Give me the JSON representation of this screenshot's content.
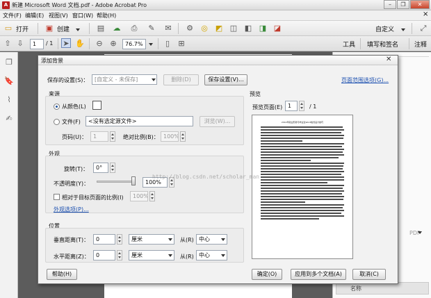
{
  "window": {
    "title": "新建 Microsoft Word 文档.pdf - Adobe Acrobat Pro",
    "app_icon_glyph": "A",
    "controls": {
      "minimize": "–",
      "restore": "❐",
      "close": "✕"
    }
  },
  "menubar": {
    "items": [
      "文件(F)",
      "编辑(E)",
      "视图(V)",
      "窗口(W)",
      "帮助(H)"
    ],
    "close_glyph": "×"
  },
  "toolbar1": {
    "open_label": "打开",
    "create_label": "创建",
    "customize_label": "自定义"
  },
  "toolbar2": {
    "page_current": "1",
    "page_total": "/ 1",
    "zoom": "76.7%",
    "tools_label": "工具",
    "sign_label": "填写和签名",
    "comment_label": "注释"
  },
  "dialog": {
    "title": "添加背景",
    "saved_settings_label": "保存的设置(S)：",
    "saved_settings_value": "[自定义 - 未保存]",
    "delete_button": "删除(D)",
    "save_settings_button": "保存设置(V)...",
    "page_range_link": "页面范围选项(G)...",
    "source": {
      "header": "来源",
      "from_color_label": "从颜色(L)",
      "from_file_label": "文件(F)",
      "file_placeholder": "<没有选定源文件>",
      "browse_button": "浏览(W)...",
      "page_no_label": "页码(U)：",
      "page_no_value": "1",
      "abs_scale_label": "绝对比例(B)：",
      "abs_scale_value": "100%"
    },
    "appearance": {
      "header": "外观",
      "rotation_label": "旋转(T)：",
      "rotation_value": "0°",
      "opacity_label": "不透明度(Y)：",
      "opacity_value": "100%",
      "opacity_fraction": 1.0,
      "relative_scale_label": "相对于目标页面的比例(I)",
      "relative_scale_value": "100%",
      "options_link": "外观选项(P)..."
    },
    "position": {
      "header": "位置",
      "vertical_label": "垂直距离(T)：",
      "vertical_value": "0",
      "vertical_unit": "厘米",
      "vertical_from_label": "从(R)",
      "vertical_from_value": "中心",
      "horizontal_label": "水平距离(Z)：",
      "horizontal_value": "0",
      "horizontal_unit": "厘米",
      "horizontal_from_label": "从(R)",
      "horizontal_from_value": "中心"
    },
    "preview": {
      "header": "预览",
      "page_label": "预览页面(E)",
      "page_value": "1",
      "page_total": "/ 1",
      "doc_title": "2014年就业形势与毕业生Word格式设计技巧",
      "watermark": "http://blog.csdn.net/scholar_man"
    },
    "help_button": "帮助(H)",
    "ok_button": "确定(O)",
    "apply_multi_button": "应用到多个文档(A)",
    "cancel_button": "取消(C)"
  },
  "right_pane": {
    "snippet": "PDF",
    "bottom_label": "名称"
  }
}
